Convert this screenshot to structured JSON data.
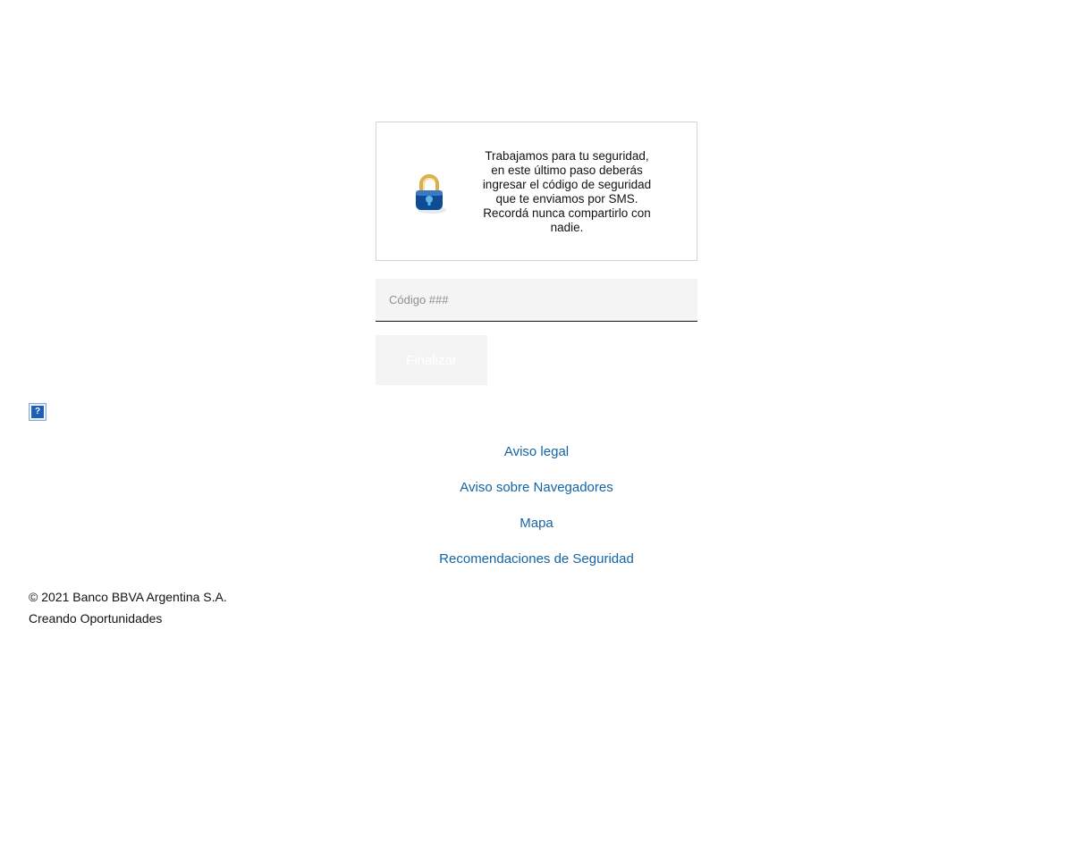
{
  "security_notice": {
    "text": "Trabajamos para tu seguridad, en este último paso deberás ingresar el código de seguridad que te enviamos por SMS. Recordá nunca compartirlo con nadie.",
    "icon": "padlock-icon"
  },
  "code_input": {
    "placeholder": "Código ###",
    "value": ""
  },
  "finish_button": {
    "label": "Finalizar"
  },
  "help": {
    "icon_glyph": "?"
  },
  "footer": {
    "links": [
      {
        "label": "Aviso legal"
      },
      {
        "label": "Aviso sobre Navegadores"
      },
      {
        "label": "Mapa"
      },
      {
        "label": "Recomendaciones de Seguridad"
      }
    ],
    "copyright_line1": "© 2021 Banco BBVA Argentina S.A.",
    "copyright_line2": "Creando Oportunidades"
  },
  "colors": {
    "link": "#1464a5",
    "lock_body": "#0f4c96",
    "lock_shackle": "#d9b14a",
    "button_bg": "#f4f4f4"
  }
}
